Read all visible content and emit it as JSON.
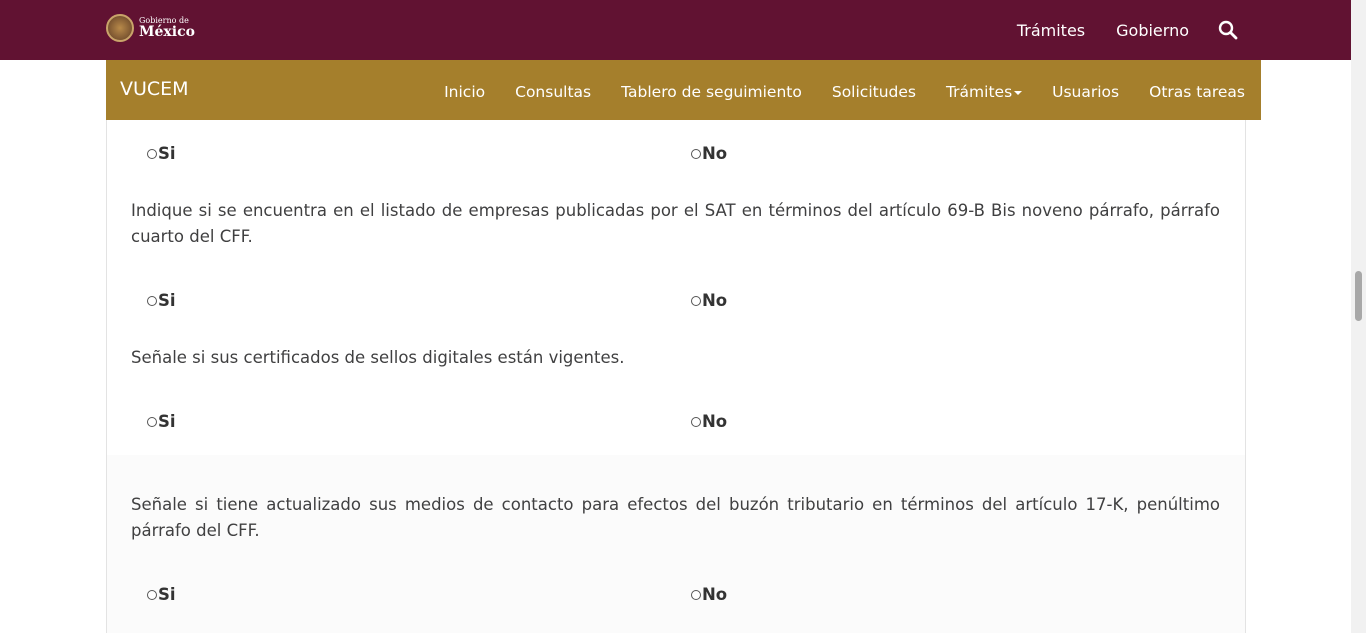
{
  "header": {
    "logo_small": "Gobierno de",
    "logo_big": "México",
    "links": [
      "Trámites",
      "Gobierno"
    ]
  },
  "navbar": {
    "brand": "VUCEM",
    "items": [
      "Inicio",
      "Consultas",
      "Tablero de seguimiento",
      "Solicitudes",
      "Trámites",
      "Usuarios",
      "Otras tareas"
    ]
  },
  "form": {
    "q0": {
      "yes": "Si",
      "no": "No"
    },
    "q1": {
      "text": "Indique si se encuentra en el listado de empresas publicadas por el SAT en términos del artículo 69-B Bis noveno párrafo, párrafo cuarto del CFF.",
      "yes": "Si",
      "no": "No"
    },
    "q2": {
      "text": "Señale si sus certificados de sellos digitales están vigentes.",
      "yes": "Si",
      "no": "No"
    },
    "q3": {
      "text": "Señale si tiene actualizado sus medios de contacto para efectos del buzón tributario en términos del artículo 17-K, penúltimo párrafo del CFF.",
      "yes": "Si",
      "no": "No"
    }
  },
  "colors": {
    "header_bg": "#611232",
    "navbar_bg": "#a57f2c",
    "text": "#404041"
  },
  "icons": {
    "search": "search-icon",
    "seal": "mexico-seal-icon"
  }
}
